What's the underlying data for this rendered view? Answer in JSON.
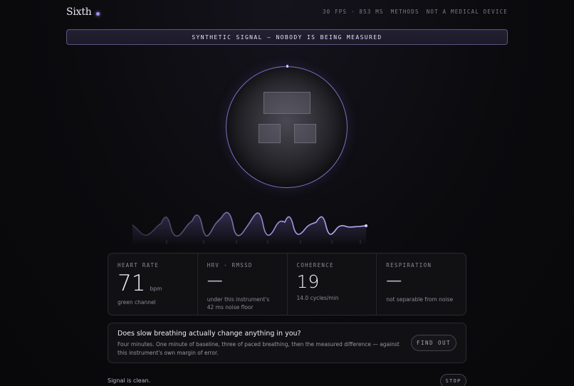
{
  "header": {
    "brand": "Sixth",
    "fps_readout": "30 FPS · 853 MS",
    "methods_label": "METHODS",
    "disclaimer": "NOT A MEDICAL DEVICE"
  },
  "banner": {
    "text": "SYNTHETIC SIGNAL — NOBODY IS BEING MEASURED"
  },
  "metrics": [
    {
      "label": "HEART RATE",
      "value": "71",
      "unit": "bpm",
      "sub": "green channel"
    },
    {
      "label": "HRV · RMSSD",
      "value": "—",
      "sub": "under this instrument's 42 ms noise floor"
    },
    {
      "label": "COHERENCE",
      "value": "19",
      "sub": "14.0 cycles/min"
    },
    {
      "label": "RESPIRATION",
      "value": "—",
      "sub": "not separable from noise"
    }
  ],
  "experiment": {
    "title": "Does slow breathing actually change anything in you?",
    "body": "Four minutes. One minute of baseline, three of paced breathing, then the measured difference — against this instrument's own margin of error.",
    "button_label": "FIND OUT"
  },
  "footer": {
    "status": "Signal is clean.",
    "stop_label": "STOP"
  },
  "colors": {
    "accent": "#a48cf0",
    "ring": "#7e6fc2",
    "banner_border": "#5e5482",
    "background": "#0b0b0e"
  }
}
